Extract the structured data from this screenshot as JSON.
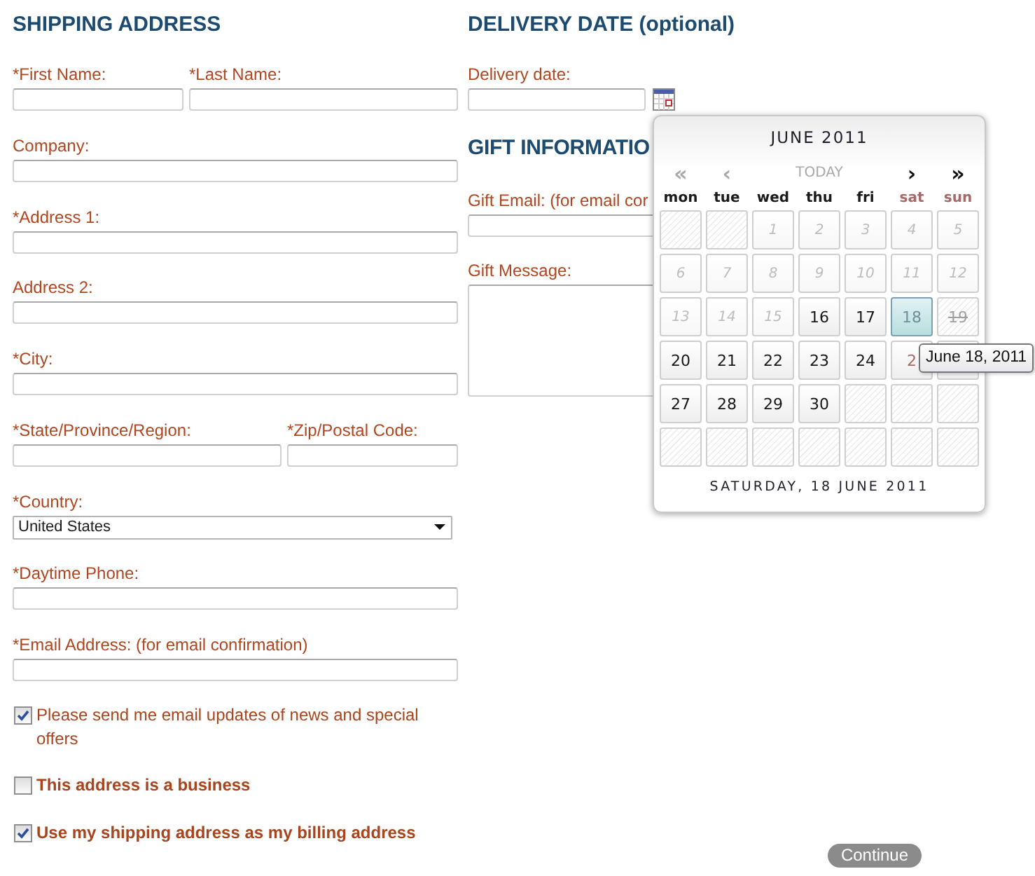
{
  "shipping": {
    "heading": "SHIPPING ADDRESS",
    "rows": [
      [
        {
          "label": "*First Name:",
          "kind": "text"
        },
        {
          "label": "*Last Name:",
          "kind": "text"
        }
      ],
      [
        {
          "label": "Company:",
          "kind": "text"
        }
      ],
      [
        {
          "label": "*Address 1:",
          "kind": "text"
        }
      ],
      [
        {
          "label": "Address 2:",
          "kind": "text"
        }
      ],
      [
        {
          "label": "*City:",
          "kind": "text"
        }
      ],
      [
        {
          "label": "*State/Province/Region:",
          "kind": "text"
        },
        {
          "label": "*Zip/Postal Code:",
          "kind": "text"
        }
      ],
      [
        {
          "label": "*Country:",
          "kind": "select",
          "value": "United States"
        }
      ],
      [
        {
          "label": "*Daytime Phone:",
          "kind": "text"
        }
      ],
      [
        {
          "label": "*Email Address: (for email confirmation)",
          "kind": "text"
        }
      ]
    ]
  },
  "checkboxes": [
    {
      "label": "Please send me email updates of news and special offers",
      "kind": "plain",
      "checked": true
    },
    {
      "label": "This address is a business",
      "kind": "strong",
      "checked": false
    },
    {
      "label": "Use my shipping address as my billing address",
      "kind": "strong",
      "checked": true
    }
  ],
  "delivery": {
    "heading": "DELIVERY DATE (optional)",
    "field": {
      "label": "Delivery date:",
      "kind": "date"
    }
  },
  "gift": {
    "heading": "GIFT INFORMATIO",
    "fields": [
      {
        "label": "Gift Email: (for email cor",
        "kind": "text"
      },
      {
        "label": "Gift Message:",
        "kind": "textarea"
      }
    ]
  },
  "date_picker": {
    "title": "JUNE 2011",
    "nav": [
      {
        "label": "«",
        "disabled": true
      },
      {
        "label": "‹",
        "disabled": true
      },
      {
        "label": "TODAY",
        "disabled": true
      },
      {
        "label": "›",
        "disabled": false
      },
      {
        "label": "»",
        "disabled": false
      }
    ],
    "weekdays": [
      {
        "label": "mon",
        "weekend": false
      },
      {
        "label": "tue",
        "weekend": false
      },
      {
        "label": "wed",
        "weekend": false
      },
      {
        "label": "thu",
        "weekend": false
      },
      {
        "label": "fri",
        "weekend": false
      },
      {
        "label": "sat",
        "weekend": true
      },
      {
        "label": "sun",
        "weekend": true
      }
    ],
    "weeks": [
      [
        {
          "kind": "empty",
          "selected": false
        },
        {
          "kind": "empty",
          "selected": false
        },
        {
          "day": "1",
          "kind": "past",
          "selected": false
        },
        {
          "day": "2",
          "kind": "past",
          "selected": false
        },
        {
          "day": "3",
          "kind": "past",
          "selected": false
        },
        {
          "day": "4",
          "kind": "past",
          "selected": false
        },
        {
          "day": "5",
          "kind": "past",
          "selected": false
        }
      ],
      [
        {
          "day": "6",
          "kind": "past",
          "selected": false
        },
        {
          "day": "7",
          "kind": "past",
          "selected": false
        },
        {
          "day": "8",
          "kind": "past",
          "selected": false
        },
        {
          "day": "9",
          "kind": "past",
          "selected": false
        },
        {
          "day": "10",
          "kind": "past",
          "selected": false
        },
        {
          "day": "11",
          "kind": "past",
          "selected": false
        },
        {
          "day": "12",
          "kind": "past",
          "selected": false
        }
      ],
      [
        {
          "day": "13",
          "kind": "past",
          "selected": false
        },
        {
          "day": "14",
          "kind": "past",
          "selected": false
        },
        {
          "day": "15",
          "kind": "past",
          "selected": false
        },
        {
          "day": "16",
          "kind": "open",
          "selected": false
        },
        {
          "day": "17",
          "kind": "open",
          "selected": false
        },
        {
          "day": "18",
          "kind": "open",
          "selected": true
        },
        {
          "day": "19",
          "kind": "booked",
          "selected": false
        }
      ],
      [
        {
          "day": "20",
          "kind": "open",
          "selected": false
        },
        {
          "day": "21",
          "kind": "open",
          "selected": false
        },
        {
          "day": "22",
          "kind": "open",
          "selected": false
        },
        {
          "day": "23",
          "kind": "open",
          "selected": false
        },
        {
          "day": "24",
          "kind": "open",
          "selected": false
        },
        {
          "day": "2",
          "kind": "open",
          "selected": false
        },
        {
          "kind": "open",
          "selected": false
        }
      ],
      [
        {
          "day": "27",
          "kind": "open",
          "selected": false
        },
        {
          "day": "28",
          "kind": "open",
          "selected": false
        },
        {
          "day": "29",
          "kind": "open",
          "selected": false
        },
        {
          "day": "30",
          "kind": "open",
          "selected": false
        },
        {
          "kind": "empty",
          "selected": false
        },
        {
          "kind": "empty",
          "selected": false
        },
        {
          "kind": "empty",
          "selected": false
        }
      ],
      [
        {
          "kind": "empty",
          "selected": false
        },
        {
          "kind": "empty",
          "selected": false
        },
        {
          "kind": "empty",
          "selected": false
        },
        {
          "kind": "empty",
          "selected": false
        },
        {
          "kind": "empty",
          "selected": false
        },
        {
          "kind": "empty",
          "selected": false
        },
        {
          "kind": "empty",
          "selected": false
        }
      ]
    ],
    "footer": "SATURDAY, 18 JUNE 2011",
    "tooltip": "June 18, 2011"
  },
  "submit": {
    "label": "Continue"
  }
}
